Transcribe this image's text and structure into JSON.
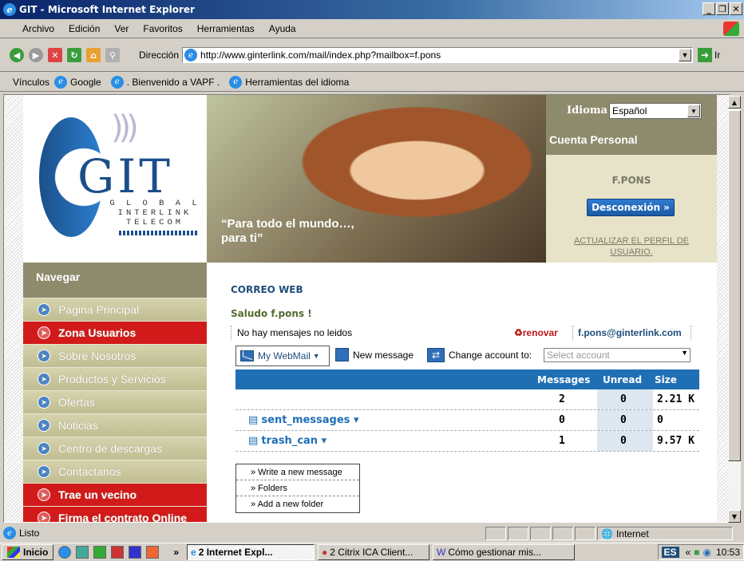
{
  "window": {
    "title": "GIT - Microsoft Internet Explorer",
    "buttons": [
      "_",
      "̈",
      "X"
    ]
  },
  "menu": [
    "Archivo",
    "Edición",
    "Ver",
    "Favoritos",
    "Herramientas",
    "Ayuda"
  ],
  "toolbar": {
    "address_label": "Dirección",
    "url": "http://www.ginterlink.com/mail/index.php?mailbox=f.pons",
    "go_label": "Ir"
  },
  "links": {
    "label": "Vínculos",
    "items": [
      "Google",
      ". Bienvenido a VAPF .",
      "Herramientas del idioma"
    ]
  },
  "logo": {
    "main": "GIT",
    "lines": [
      "G L O B A L",
      "INTERLINK",
      "TELECOM"
    ]
  },
  "banner": {
    "tagline_1": "“Para todo el mundo…,",
    "tagline_2": "para ti”"
  },
  "account_panel": {
    "language_label": "Idioma",
    "language_value": "Español",
    "title": "Cuenta Personal",
    "username": "F.PONS",
    "logout_label": "Desconexión »",
    "update_profile_label": "ACTUALIZAR EL PERFIL DE USUARIO."
  },
  "nav": {
    "title": "Navegar",
    "items": [
      {
        "label": "Pagina Principal",
        "highlight": false
      },
      {
        "label": "Zona Usuarios",
        "highlight": true
      },
      {
        "label": "Sobre Nosotros",
        "highlight": false
      },
      {
        "label": "Productos y Servicios",
        "highlight": false
      },
      {
        "label": "Ofertas",
        "highlight": false
      },
      {
        "label": "Noticias",
        "highlight": false
      },
      {
        "label": "Centro de descargas",
        "highlight": false
      },
      {
        "label": "Contactanos",
        "highlight": false
      },
      {
        "label": "Trae un vecino",
        "highlight": true
      },
      {
        "label": "Firma el contrato Online",
        "highlight": true
      }
    ]
  },
  "webmail": {
    "section_title": "CORREO WEB",
    "greeting": "Saludo f.pons !",
    "no_messages": "No hay mensajes no leidos",
    "renew_label": "renovar",
    "email": "f.pons@ginterlink.com",
    "my_webmail_label": "My WebMail",
    "new_message_label": "New message",
    "change_account_label": "Change account to:",
    "select_account_placeholder": "Select account",
    "menu_items": [
      "» Write a new message",
      "» Folders",
      "» Add a new folder"
    ],
    "columns": [
      "Messages",
      "Unread",
      "Size"
    ],
    "folders": [
      {
        "name": "",
        "messages": "2",
        "unread": "0",
        "size": "2.21 K"
      },
      {
        "name": "sent_messages",
        "messages": "0",
        "unread": "0",
        "size": "0"
      },
      {
        "name": "trash_can",
        "messages": "1",
        "unread": "0",
        "size": "9.57 K"
      }
    ]
  },
  "statusbar": {
    "status": "Listo",
    "zone": "Internet"
  },
  "taskbar": {
    "start_label": "Inicio",
    "tasks": [
      "2 Internet Expl...",
      "2 Citrix ICA Client...",
      "Cómo gestionar mis..."
    ],
    "lang": "ES",
    "clock": "10:53"
  },
  "colors": {
    "accent_blue": "#1f6fb5",
    "nav_red": "#d21a1a",
    "panel_olive": "#8e8a6c"
  }
}
